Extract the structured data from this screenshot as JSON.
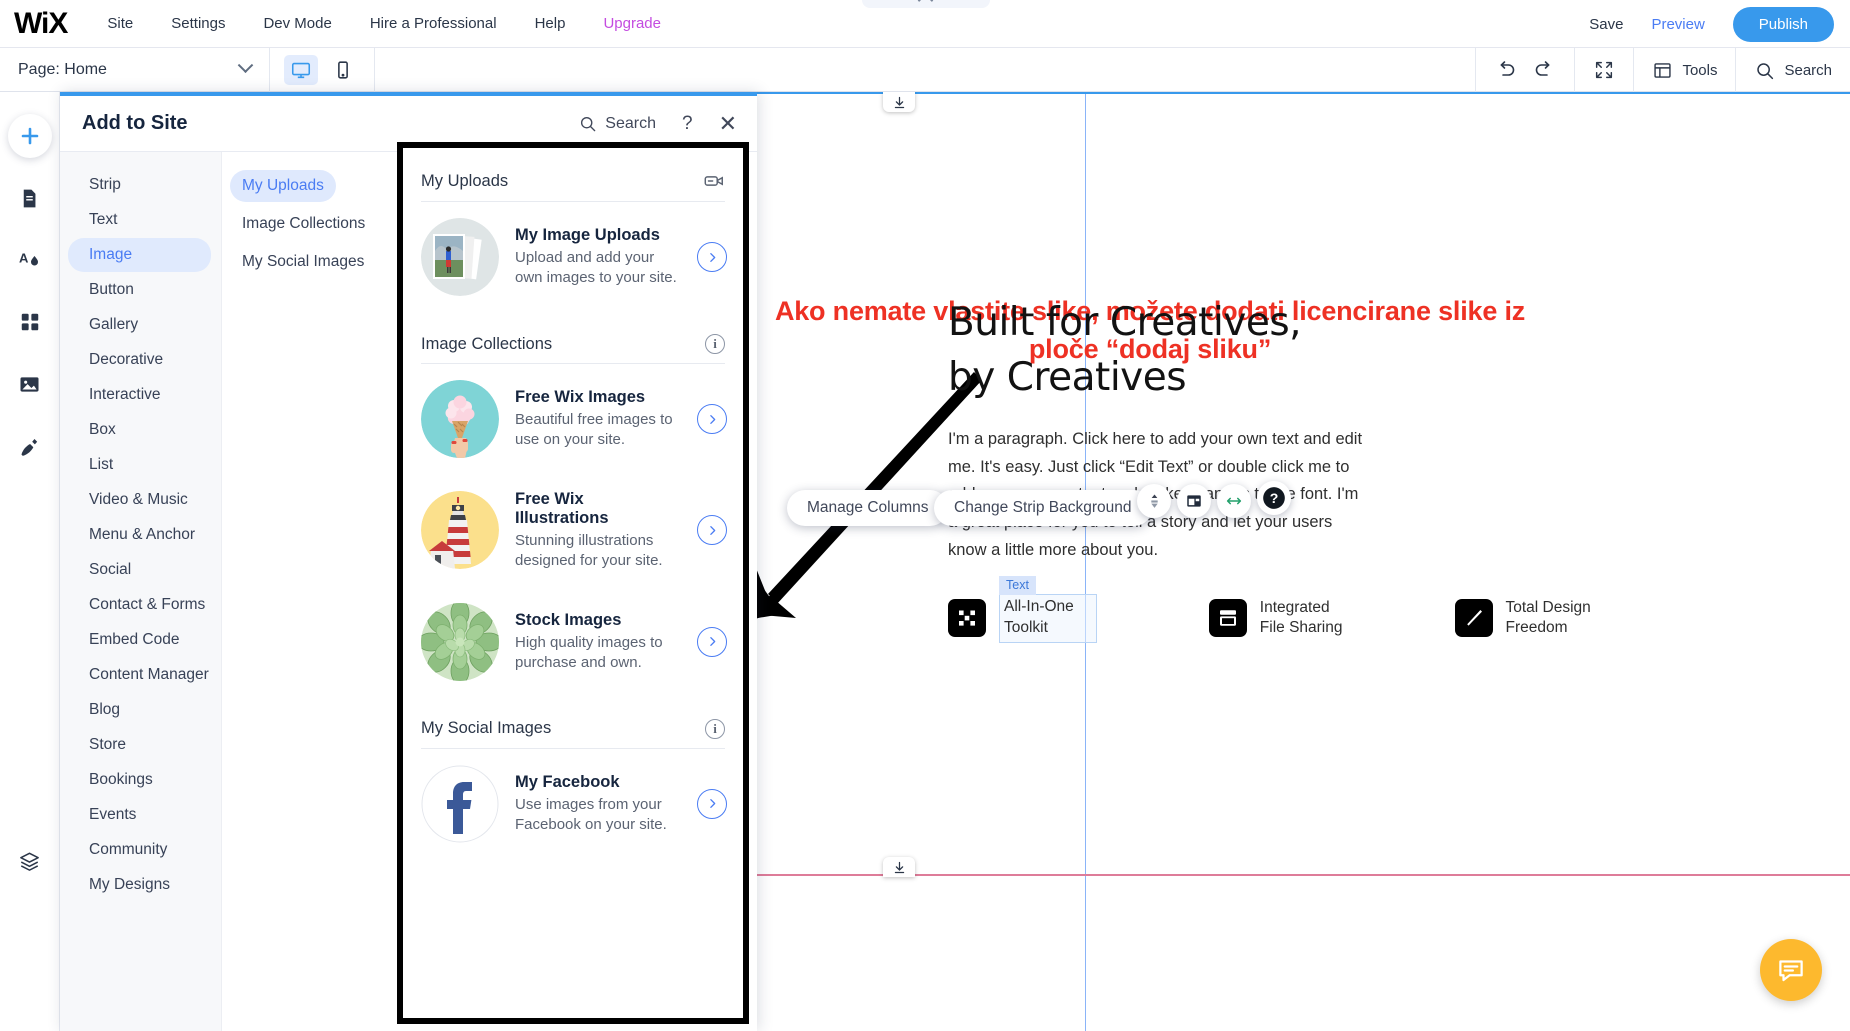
{
  "topbar": {
    "logo": "WiX",
    "nav": [
      {
        "label": "Site"
      },
      {
        "label": "Settings"
      },
      {
        "label": "Dev Mode"
      },
      {
        "label": "Hire a Professional"
      },
      {
        "label": "Help"
      },
      {
        "label": "Upgrade"
      }
    ],
    "save": "Save",
    "preview": "Preview",
    "publish": "Publish"
  },
  "secondbar": {
    "page_label": "Page: Home",
    "tools": "Tools",
    "search": "Search"
  },
  "panel": {
    "title": "Add to Site",
    "search": "Search",
    "help": "?",
    "close": "✕",
    "categories": [
      {
        "label": "Strip",
        "active": false
      },
      {
        "label": "Text",
        "active": false
      },
      {
        "label": "Image",
        "active": true
      },
      {
        "label": "Button",
        "active": false
      },
      {
        "label": "Gallery",
        "active": false
      },
      {
        "label": "Decorative",
        "active": false
      },
      {
        "label": "Interactive",
        "active": false
      },
      {
        "label": "Box",
        "active": false
      },
      {
        "label": "List",
        "active": false
      },
      {
        "label": "Video & Music",
        "active": false
      },
      {
        "label": "Menu & Anchor",
        "active": false
      },
      {
        "label": "Social",
        "active": false
      },
      {
        "label": "Contact & Forms",
        "active": false
      },
      {
        "label": "Embed Code",
        "active": false
      },
      {
        "label": "Content Manager",
        "active": false
      },
      {
        "label": "Blog",
        "active": false
      },
      {
        "label": "Store",
        "active": false
      },
      {
        "label": "Bookings",
        "active": false
      },
      {
        "label": "Events",
        "active": false
      },
      {
        "label": "Community",
        "active": false
      },
      {
        "label": "My Designs",
        "active": false
      }
    ],
    "subcategories": [
      {
        "label": "My Uploads",
        "active": true
      },
      {
        "label": "Image Collections",
        "active": false
      },
      {
        "label": "My Social Images",
        "active": false
      }
    ],
    "sections": [
      {
        "heading": "My Uploads",
        "header_icon": "video-camera-icon",
        "items": [
          {
            "title": "My Image Uploads",
            "subtitle": "Upload and add your own images to your site.",
            "thumb": "photo-stack-hiker-thumb"
          }
        ]
      },
      {
        "heading": "Image Collections",
        "header_icon": "info-icon",
        "items": [
          {
            "title": "Free Wix Images",
            "subtitle": "Beautiful free images to use on your site.",
            "thumb": "ice-cream-hand-thumb"
          },
          {
            "title": "Free Wix Illustrations",
            "subtitle": "Stunning illustrations designed for your site.",
            "thumb": "lighthouse-thumb"
          },
          {
            "title": "Stock Images",
            "subtitle": "High quality images to purchase and own.",
            "thumb": "succulent-plant-thumb"
          }
        ]
      },
      {
        "heading": "My Social Images",
        "header_icon": "info-icon",
        "items": [
          {
            "title": "My Facebook",
            "subtitle": "Use images from your Facebook on your site.",
            "thumb": "facebook-logo-thumb"
          }
        ]
      }
    ]
  },
  "canvas": {
    "annotation": "Ako nemate vlastite slike, možete dodati licencirane slike iz ploče “dodaj sliku”",
    "annotation_color": "#ee3124",
    "hero_title_line1": "Built for Creatives,",
    "hero_title_line2": "by Creatives",
    "paragraph": "I'm a paragraph. Click here to add your own text and edit me. It's easy. Just click “Edit Text” or double click me to add your own content and make changes to the font. I'm a great place for you to tell a story and let your users know a little more about you.",
    "features": [
      {
        "title_line1": "All-In-One",
        "title_line2": "Toolkit",
        "icon": "toolkit-grid-icon",
        "tag": "Text",
        "selected": true
      },
      {
        "title_line1": "Integrated",
        "title_line2": "File Sharing",
        "icon": "window-file-icon",
        "tag": "",
        "selected": false
      },
      {
        "title_line1": "Total Design",
        "title_line2": "Freedom",
        "icon": "paintbrush-icon",
        "tag": "",
        "selected": false
      }
    ],
    "tooltips": [
      {
        "label": "Manage Columns"
      },
      {
        "label": "Change Strip Background"
      }
    ]
  }
}
